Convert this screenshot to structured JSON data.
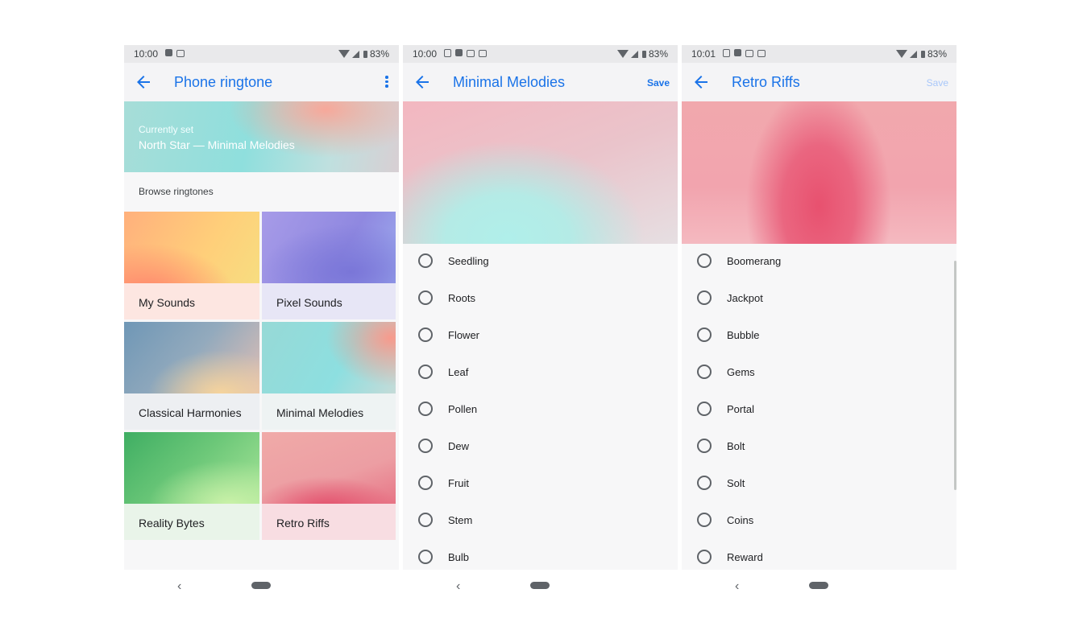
{
  "screen1": {
    "status": {
      "time": "10:00",
      "battery": "83%"
    },
    "toolbar": {
      "title": "Phone ringtone"
    },
    "current": {
      "label": "Currently set",
      "value": "North Star — Minimal Melodies"
    },
    "browse_label": "Browse ringtones",
    "categories": [
      {
        "label": "My Sounds"
      },
      {
        "label": "Pixel Sounds"
      },
      {
        "label": "Classical Harmonies"
      },
      {
        "label": "Minimal Melodies"
      },
      {
        "label": "Reality Bytes"
      },
      {
        "label": "Retro Riffs"
      }
    ]
  },
  "screen2": {
    "status": {
      "time": "10:00",
      "battery": "83%"
    },
    "toolbar": {
      "title": "Minimal Melodies",
      "save_label": "Save"
    },
    "ringtones": [
      "Seedling",
      "Roots",
      "Flower",
      "Leaf",
      "Pollen",
      "Dew",
      "Fruit",
      "Stem",
      "Bulb"
    ]
  },
  "screen3": {
    "status": {
      "time": "10:01",
      "battery": "83%"
    },
    "toolbar": {
      "title": "Retro Riffs",
      "save_label": "Save"
    },
    "ringtones": [
      "Boomerang",
      "Jackpot",
      "Bubble",
      "Gems",
      "Portal",
      "Bolt",
      "Solt",
      "Coins",
      "Reward"
    ]
  },
  "nav": {
    "back_glyph": "‹"
  },
  "colors": {
    "accent": "#1a73e8",
    "save_disabled": "#a8c7fa",
    "background": "#f7f7f8"
  },
  "icons": [
    "arrow-back-icon",
    "more-vert-icon",
    "wifi-icon",
    "signal-icon",
    "battery-icon",
    "notification-icon"
  ]
}
